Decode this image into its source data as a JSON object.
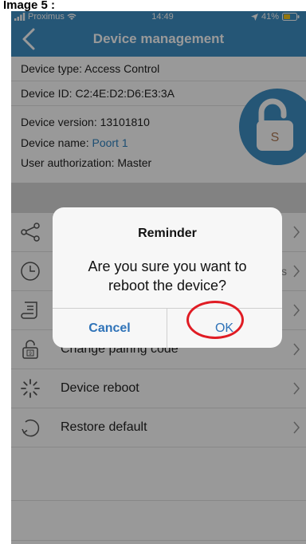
{
  "caption": "Image 5 :",
  "status_bar": {
    "carrier": "Proximus",
    "time": "14:49",
    "battery": "41%",
    "colors": {
      "battery_fill": "#f5c518"
    },
    "icons": [
      "signal-icon",
      "wifi-icon",
      "location-icon",
      "battery-icon"
    ]
  },
  "header": {
    "title": "Device management",
    "back_icon": "chevron-left-icon",
    "background": "#3f8fc5"
  },
  "device_info": {
    "type": "Device type: Access Control",
    "id": "Device ID: C2:4E:D2:D6:E3:3A",
    "version": "Device version: 13101810",
    "name_prefix": "Device name: ",
    "name_value": "Poort 1",
    "authorization": "User authorization: Master",
    "lock_badge": "S"
  },
  "menu": {
    "items": [
      {
        "icon": "share-icon",
        "label": "",
        "value": ""
      },
      {
        "icon": "clock-icon",
        "label": "",
        "value": "0s"
      },
      {
        "icon": "log-icon",
        "label": "",
        "value": ""
      },
      {
        "icon": "padlock-icon",
        "label": "Change pairing code",
        "value": ""
      },
      {
        "icon": "spinner-icon",
        "label": "Device reboot",
        "value": ""
      },
      {
        "icon": "restore-icon",
        "label": "Restore default",
        "value": ""
      }
    ]
  },
  "dialog": {
    "title": "Reminder",
    "message": "Are you sure you want to reboot the device?",
    "cancel_label": "Cancel",
    "ok_label": "OK",
    "highlight_color": "#e01c24"
  }
}
